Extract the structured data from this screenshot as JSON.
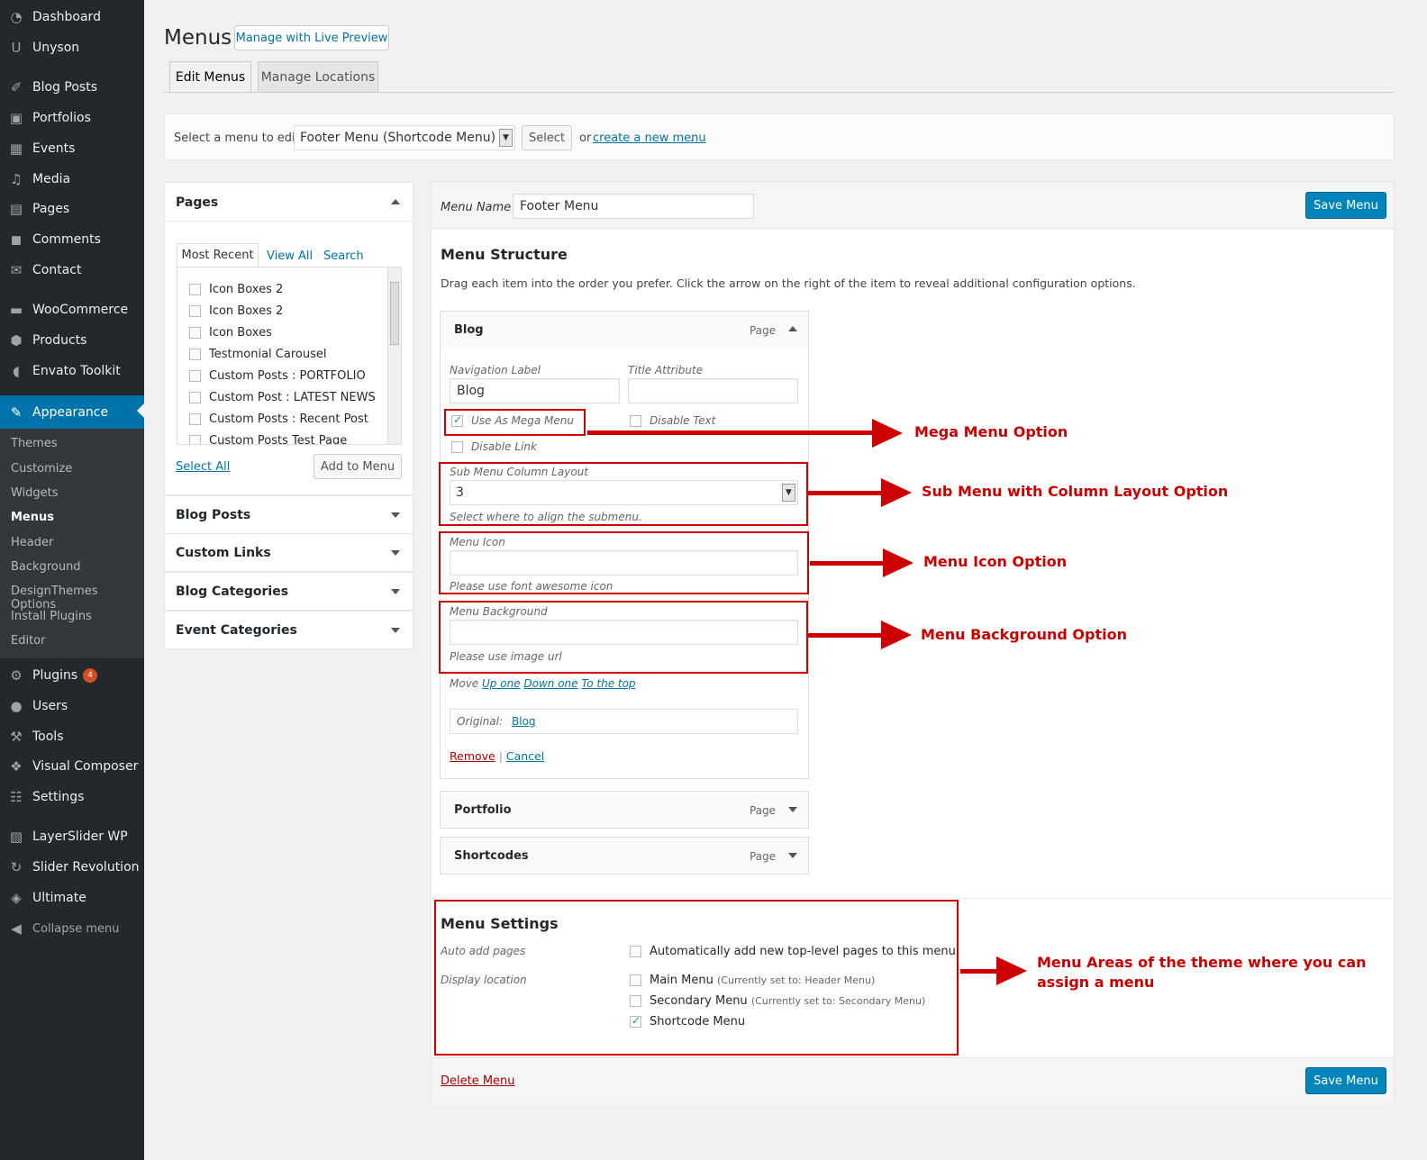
{
  "sidebar": {
    "items": [
      {
        "label": "Dashboard",
        "icon": "dashboard-icon",
        "glyph": "◔"
      },
      {
        "label": "Unyson",
        "icon": "unyson-icon",
        "glyph": "U"
      },
      {
        "label": "Blog Posts",
        "icon": "pin-icon",
        "glyph": "✐"
      },
      {
        "label": "Portfolios",
        "icon": "portfolio-icon",
        "glyph": "▣"
      },
      {
        "label": "Events",
        "icon": "calendar-icon",
        "glyph": "▦"
      },
      {
        "label": "Media",
        "icon": "media-icon",
        "glyph": "♫"
      },
      {
        "label": "Pages",
        "icon": "pages-icon",
        "glyph": "▤"
      },
      {
        "label": "Comments",
        "icon": "comments-icon",
        "glyph": "◼"
      },
      {
        "label": "Contact",
        "icon": "envelope-icon",
        "glyph": "✉"
      },
      {
        "label": "WooCommerce",
        "icon": "woocommerce-icon",
        "glyph": "▬"
      },
      {
        "label": "Products",
        "icon": "products-icon",
        "glyph": "⬢"
      },
      {
        "label": "Envato Toolkit",
        "icon": "envato-icon",
        "glyph": "◖"
      },
      {
        "label": "Appearance",
        "icon": "brush-icon",
        "glyph": "✎"
      },
      {
        "label": "Plugins",
        "icon": "plug-icon",
        "glyph": "⚙"
      },
      {
        "label": "Users",
        "icon": "user-icon",
        "glyph": "●"
      },
      {
        "label": "Tools",
        "icon": "wrench-icon",
        "glyph": "⚒"
      },
      {
        "label": "Visual Composer",
        "icon": "visual-composer-icon",
        "glyph": "❖"
      },
      {
        "label": "Settings",
        "icon": "settings-icon",
        "glyph": "☷"
      },
      {
        "label": "LayerSlider WP",
        "icon": "layerslider-icon",
        "glyph": "▧"
      },
      {
        "label": "Slider Revolution",
        "icon": "refresh-icon",
        "glyph": "↻"
      },
      {
        "label": "Ultimate",
        "icon": "shield-icon",
        "glyph": "◈"
      },
      {
        "label": "Collapse menu",
        "icon": "collapse-icon",
        "glyph": "◀"
      }
    ],
    "plugins_badge": "4",
    "submenu": [
      "Themes",
      "Customize",
      "Widgets",
      "Menus",
      "Header",
      "Background",
      "DesignThemes Options",
      "Install Plugins",
      "Editor"
    ]
  },
  "header": {
    "title": "Menus",
    "live_preview": "Manage with Live Preview",
    "tabs": [
      "Edit Menus",
      "Manage Locations"
    ]
  },
  "select_bar": {
    "label": "Select a menu to edit:",
    "selected": "Footer Menu (Shortcode Menu)",
    "button": "Select",
    "or_text": "or",
    "create_link": "create a new menu",
    "period": "."
  },
  "pages_box": {
    "title": "Pages",
    "tabs": [
      "Most Recent",
      "View All",
      "Search"
    ],
    "items": [
      "Icon Boxes 2",
      "Icon Boxes 2",
      "Icon Boxes",
      "Testmonial Carousel",
      "Custom Posts : PORTFOLIO",
      "Custom Post : LATEST NEWS",
      "Custom Posts : Recent Post",
      "Custom Posts Test Page"
    ],
    "select_all": "Select All",
    "add_button": "Add to Menu"
  },
  "accordions": [
    "Blog Posts",
    "Custom Links",
    "Blog Categories",
    "Event Categories"
  ],
  "menu_edit": {
    "name_label": "Menu Name",
    "name_value": "Footer Menu",
    "save_label": "Save Menu",
    "structure_title": "Menu Structure",
    "structure_desc": "Drag each item into the order you prefer. Click the arrow on the right of the item to reveal additional configuration options.",
    "delete_label": "Delete Menu"
  },
  "blog_item": {
    "title": "Blog",
    "type": "Page",
    "nav_label_caption": "Navigation Label",
    "nav_label_value": "Blog",
    "title_attr_caption": "Title Attribute",
    "title_attr_value": "",
    "mega_menu_label": "Use As Mega Menu",
    "disable_text_label": "Disable Text",
    "disable_link_label": "Disable Link",
    "column_layout_caption": "Sub Menu Column Layout",
    "column_layout_value": "3",
    "column_layout_help": "Select where to align the submenu.",
    "menu_icon_caption": "Menu Icon",
    "menu_icon_help": "Please use font awesome icon",
    "menu_bg_caption": "Menu Background",
    "menu_bg_help": "Please use image url",
    "move_label": "Move",
    "move_up": "Up one",
    "move_down": "Down one",
    "move_top": "To the top",
    "original_label": "Original:",
    "original_link": "Blog",
    "remove": "Remove",
    "separator": "|",
    "cancel": "Cancel"
  },
  "other_items": [
    {
      "title": "Portfolio",
      "type": "Page"
    },
    {
      "title": "Shortcodes",
      "type": "Page"
    }
  ],
  "menu_settings": {
    "title": "Menu Settings",
    "auto_add_label": "Auto add pages",
    "auto_add_option": "Automatically add new top-level pages to this menu",
    "display_location_label": "Display location",
    "locations": [
      {
        "label": "Main Menu",
        "note": "(Currently set to: Header Menu)",
        "checked": false
      },
      {
        "label": "Secondary Menu",
        "note": "(Currently set to: Secondary Menu)",
        "checked": false
      },
      {
        "label": "Shortcode Menu",
        "note": "",
        "checked": true
      }
    ]
  },
  "annotations": {
    "mega": "Mega Menu Option",
    "column": "Sub Menu with Column Layout Option",
    "icon": "Menu Icon Option",
    "background": "Menu Background Option",
    "areas_line1": "Menu Areas of the theme where you can",
    "areas_line2": "assign a menu"
  },
  "colors": {
    "sidebar_bg": "#23282d",
    "accent": "#0073aa",
    "annotation_red": "#cc0000"
  }
}
